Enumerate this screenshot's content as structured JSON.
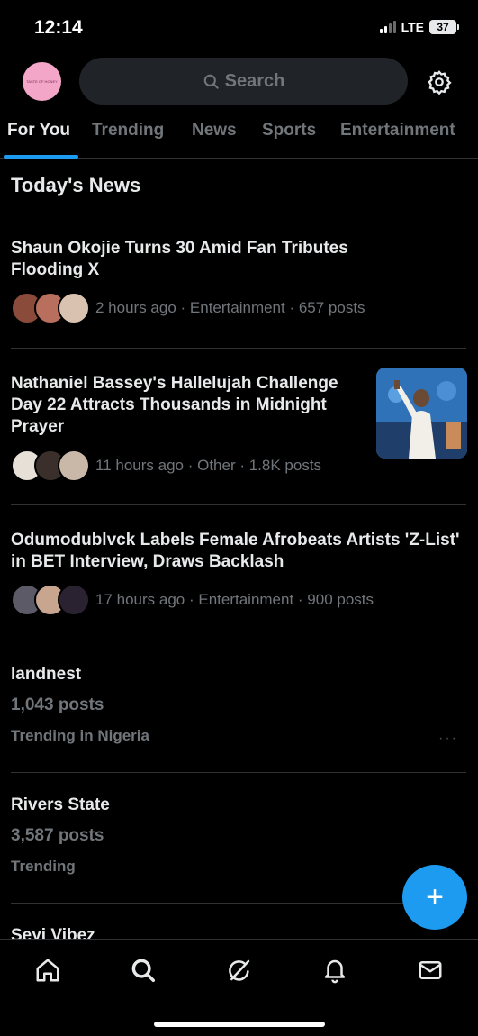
{
  "status_bar": {
    "time": "12:14",
    "network": "LTE",
    "battery": "37"
  },
  "header": {
    "search_placeholder": "Search",
    "avatar_text": "TASTE OF HONEY"
  },
  "tabs": [
    {
      "label": "For You",
      "active": true
    },
    {
      "label": "Trending",
      "active": false
    },
    {
      "label": "News",
      "active": false
    },
    {
      "label": "Sports",
      "active": false
    },
    {
      "label": "Entertainment",
      "active": false
    }
  ],
  "section_title": "Today's News",
  "news": [
    {
      "title": "Shaun Okojie Turns 30 Amid Fan Tributes Flooding X",
      "meta": "2 hours ago · Entertainment · 657 posts"
    },
    {
      "title": "Nathaniel Bassey's Hallelujah Challenge Day 22 Attracts Thousands in Midnight Prayer",
      "meta": "11 hours ago · Other · 1.8K posts"
    },
    {
      "title": "Odumodublvck Labels Female Afrobeats Artists 'Z-List' in BET Interview, Draws Backlash",
      "meta": "17 hours ago · Entertainment · 900 posts"
    }
  ],
  "trends": [
    {
      "name": "landnest",
      "posts": "1,043 posts",
      "context": "Trending in Nigeria"
    },
    {
      "name": "Rivers State",
      "posts": "3,587 posts",
      "context": "Trending"
    },
    {
      "name": "Seyi Vibez"
    }
  ],
  "colors": {
    "accent": "#1d9bf0",
    "background": "#000000",
    "muted": "#71767b",
    "text": "#e7e9ea"
  },
  "icons": [
    "search-icon",
    "gear-icon",
    "home-icon",
    "grok-icon",
    "bell-icon",
    "mail-icon",
    "plus-icon"
  ]
}
